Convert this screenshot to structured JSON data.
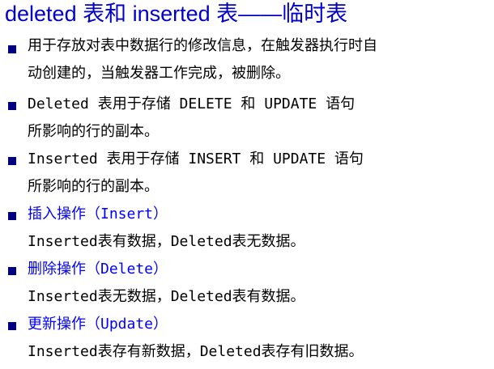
{
  "title": "deleted 表和 inserted 表——临时表",
  "bullets": [
    {
      "line1": "用于存放对表中数据行的修改信息，在触发器执行时自",
      "line2": "动创建的，当触发器工作完成，被删除。"
    },
    {
      "line1": "Deleted 表用于存储 DELETE 和 UPDATE 语句",
      "line2": "所影响的行的副本。"
    },
    {
      "line1": "Inserted 表用于存储 INSERT 和 UPDATE 语句",
      "line2": "所影响的行的副本。"
    },
    {
      "line1": "插入操作（Insert）",
      "line2": "Inserted表有数据，Deleted表无数据。"
    },
    {
      "line1": "删除操作（Delete）",
      "line2": "Inserted表无数据，Deleted表有数据。"
    },
    {
      "line1": "更新操作（Update）",
      "line2": "Inserted表存有新数据，Deleted表存有旧数据。"
    }
  ],
  "colors": {
    "title": "#0000cc",
    "bullet": "#000080",
    "operation_heading": "#0000ff",
    "body_text": "#000000"
  }
}
